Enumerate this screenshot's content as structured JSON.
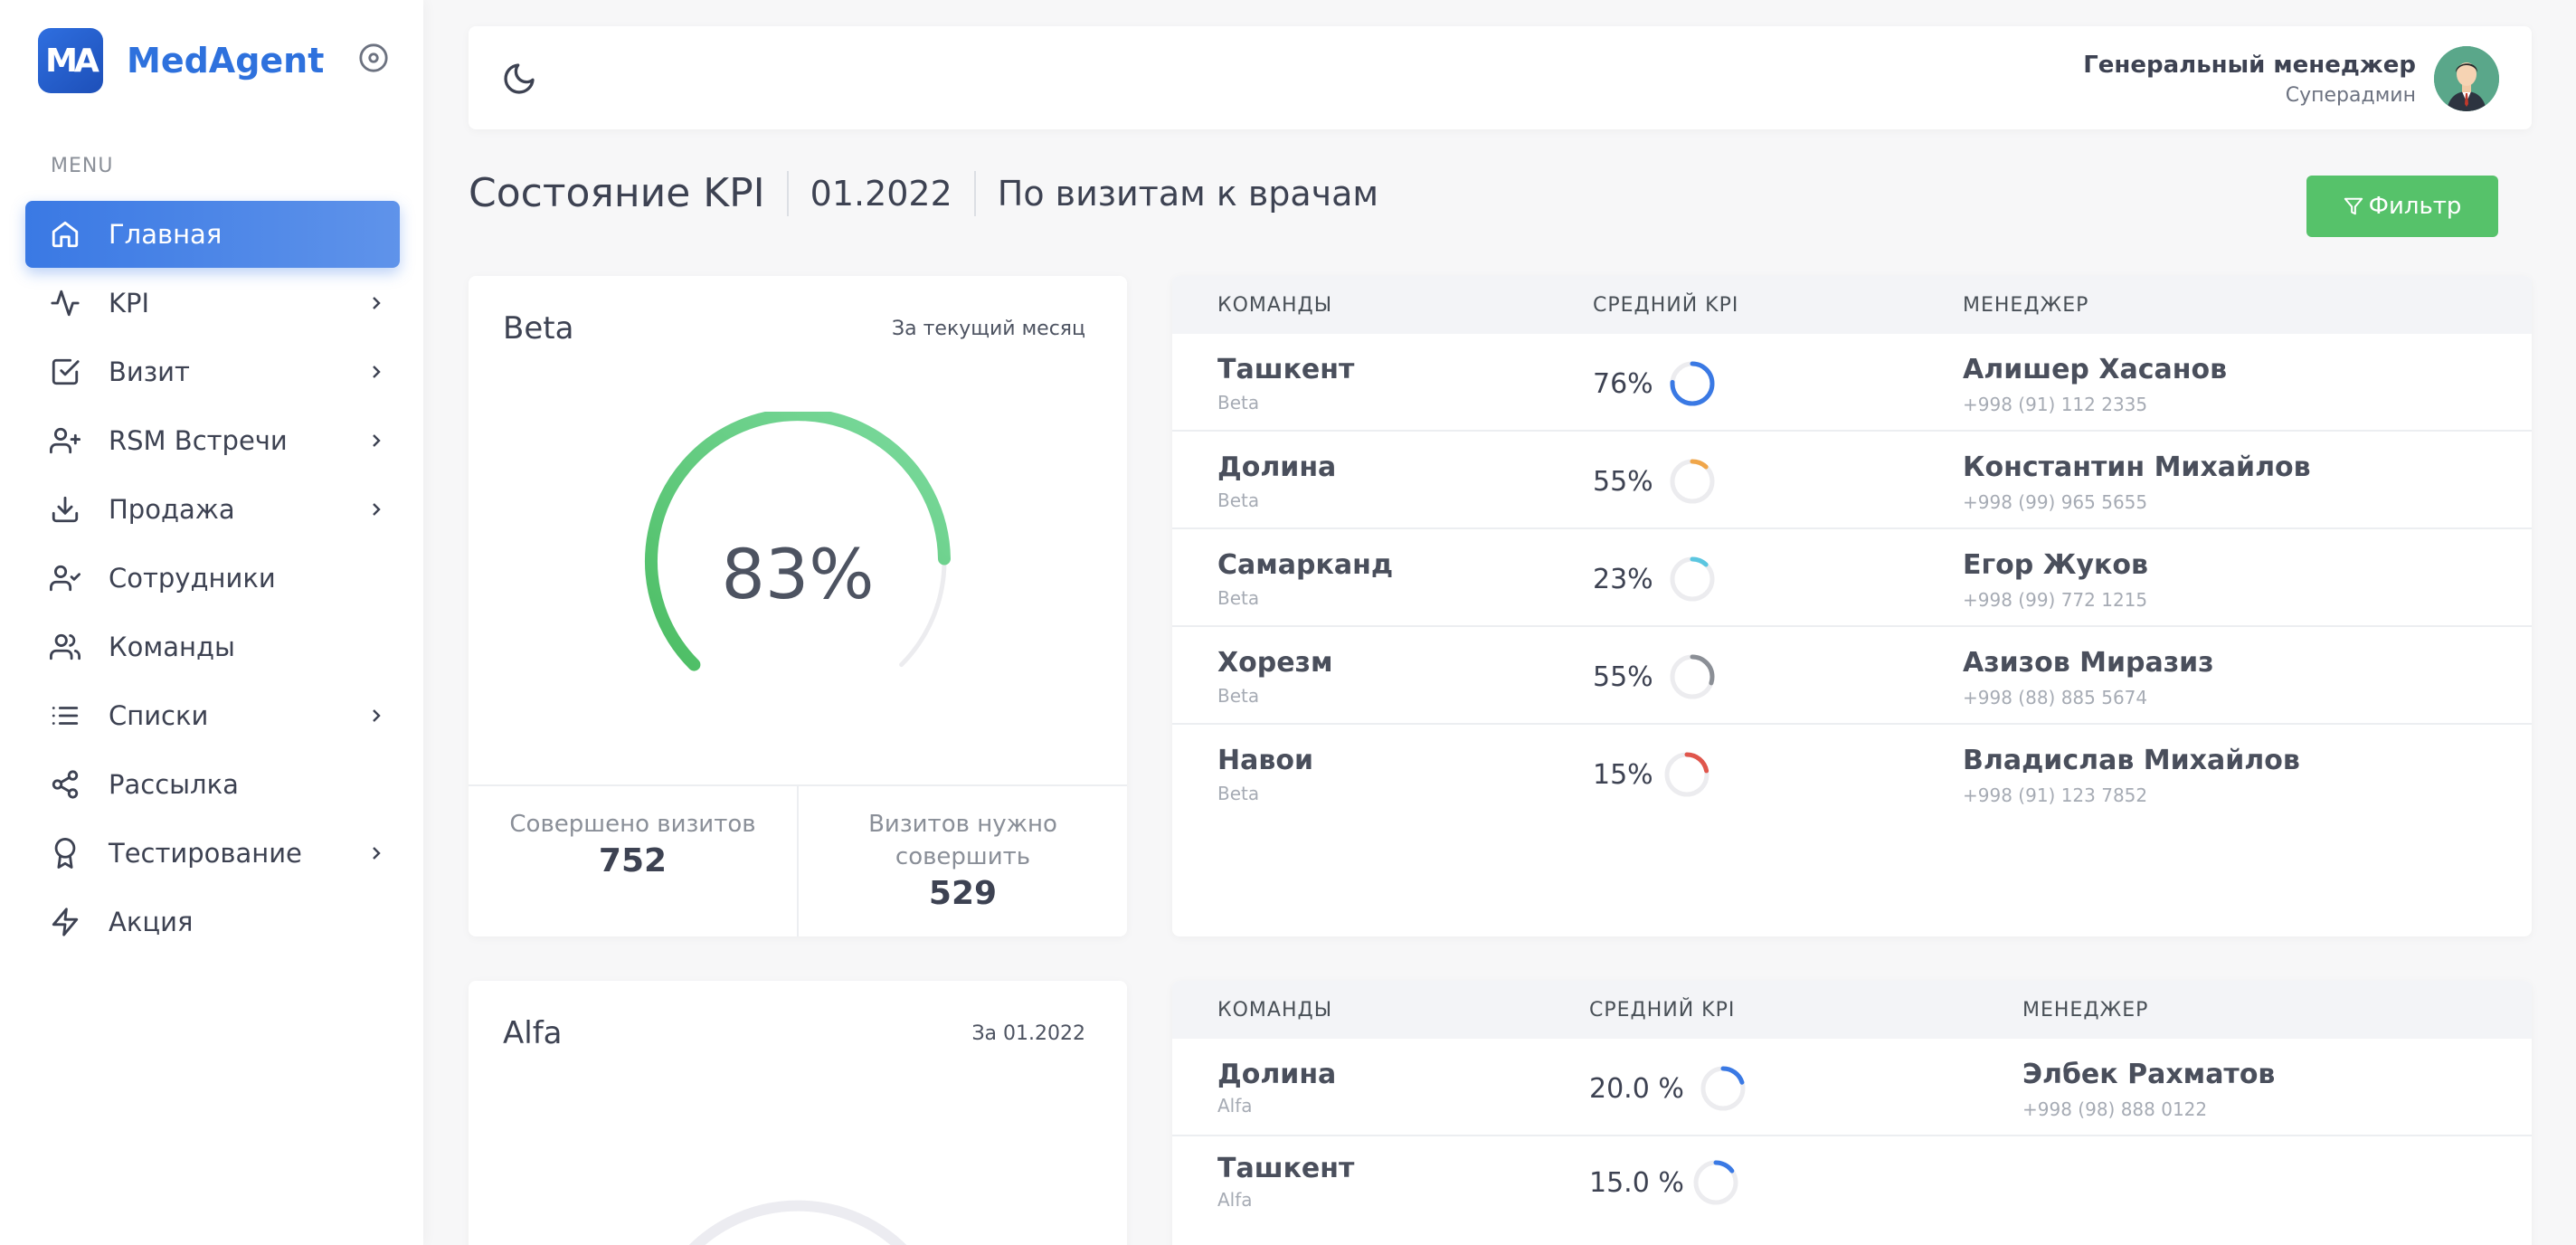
{
  "brand": {
    "logo_text": "MA",
    "name": "MedAgent"
  },
  "sidebar": {
    "menu_title": "MENU",
    "items": [
      {
        "label": "Главная",
        "icon": "home-icon",
        "active": true,
        "has_children": false
      },
      {
        "label": "KPI",
        "icon": "activity-icon",
        "active": false,
        "has_children": true
      },
      {
        "label": "Визит",
        "icon": "check-square-icon",
        "active": false,
        "has_children": true
      },
      {
        "label": "RSM Встречи",
        "icon": "user-plus-icon",
        "active": false,
        "has_children": true
      },
      {
        "label": "Продажа",
        "icon": "download-icon",
        "active": false,
        "has_children": true
      },
      {
        "label": "Сотрудники",
        "icon": "user-check-icon",
        "active": false,
        "has_children": false
      },
      {
        "label": "Команды",
        "icon": "users-icon",
        "active": false,
        "has_children": false
      },
      {
        "label": "Списки",
        "icon": "list-icon",
        "active": false,
        "has_children": true
      },
      {
        "label": "Рассылка",
        "icon": "share-icon",
        "active": false,
        "has_children": false
      },
      {
        "label": "Тестирование",
        "icon": "award-icon",
        "active": false,
        "has_children": true
      },
      {
        "label": "Акция",
        "icon": "zap-icon",
        "active": false,
        "has_children": false
      }
    ]
  },
  "topbar": {
    "user_role": "Генеральный менеджер",
    "user_sub": "Суперадмин"
  },
  "page": {
    "title": "Состояние KPI",
    "date": "01.2022",
    "subtitle": "По визитам к врачам",
    "filter_label": "Фильтр"
  },
  "kpi_cards": [
    {
      "title": "Beta",
      "period": "За текущий месяц",
      "percent": 83,
      "percent_label": "83%",
      "done_label": "Совершено визитов",
      "done_value": "752",
      "need_label": "Визитов нужно совершить",
      "need_value": "529"
    },
    {
      "title": "Alfa",
      "period": "За 01.2022"
    }
  ],
  "tables": [
    {
      "headers": {
        "team": "КОМАНДЫ",
        "kpi": "СРЕДНИЙ KPI",
        "manager": "МЕНЕДЖЕР"
      },
      "rows": [
        {
          "team": "Ташкент",
          "sub": "Beta",
          "kpi": "76%",
          "pct": 76,
          "color": "#3a79e4",
          "manager": "Алишер Хасанов",
          "phone": "+998 (91) 112 2335"
        },
        {
          "team": "Долина",
          "sub": "Beta",
          "kpi": "55%",
          "pct": 12,
          "color": "#f0a64a",
          "manager": "Константин Михайлов",
          "phone": "+998 (99) 965 5655"
        },
        {
          "team": "Самарканд",
          "sub": "Beta",
          "kpi": "23%",
          "pct": 12,
          "color": "#5bc6e0",
          "manager": "Егор Жуков",
          "phone": "+998 (99) 772 1215"
        },
        {
          "team": "Хорезм",
          "sub": "Beta",
          "kpi": "55%",
          "pct": 30,
          "color": "#8b8f96",
          "manager": "Азизов Миразиз",
          "phone": "+998 (88) 885 5674"
        },
        {
          "team": "Навои",
          "sub": "Beta",
          "kpi": "15%",
          "pct": 22,
          "color": "#e0564c",
          "manager": "Владислав Михайлов",
          "phone": "+998 (91) 123 7852"
        }
      ]
    },
    {
      "headers": {
        "team": "КОМАНДЫ",
        "kpi": "СРЕДНИЙ KPI",
        "manager": "МЕНЕДЖЕР"
      },
      "rows": [
        {
          "team": "Долина",
          "sub": "Alfa",
          "kpi": "20.0 %",
          "pct": 20,
          "color": "#3a79e4",
          "manager": "Элбек Рахматов",
          "phone": "+998 (98) 888 0122"
        },
        {
          "team": "Ташкент",
          "sub": "Alfa",
          "kpi": "15.0 %",
          "pct": 15,
          "color": "#3a79e4",
          "manager": "",
          "phone": ""
        }
      ]
    }
  ]
}
